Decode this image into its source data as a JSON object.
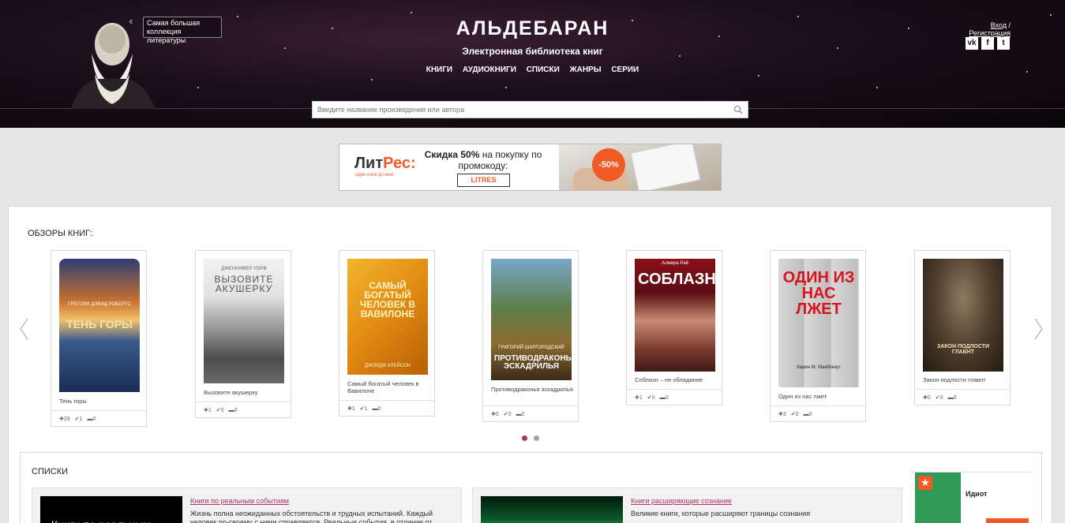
{
  "header": {
    "collection_text": "Самая большая коллекция литературы",
    "logo": "АЛЬДЕБАРАН",
    "tagline": "Электронная библиотека книг",
    "nav": [
      "КНИГИ",
      "АУДИОКНИГИ",
      "СПИСКИ",
      "ЖАНРЫ",
      "СЕРИИ"
    ],
    "auth": {
      "login": "Вход",
      "separator": " / ",
      "register": "Регистрация"
    },
    "socials": [
      "vk-icon",
      "facebook-icon",
      "twitter-icon"
    ]
  },
  "search": {
    "placeholder": "Введите название произведения или автора"
  },
  "banner": {
    "logo_main": "Лит",
    "logo_accent": "Рес:",
    "logo_sub": "один клик до книг",
    "promo_bold": "Скидка 50%",
    "promo_rest": " на покупку по промокоду:",
    "promo_code": "LITRES",
    "discount": "-50%"
  },
  "reviews": {
    "title": "ОБЗОРЫ КНИГ:",
    "books": [
      {
        "cover_title": "ТЕНЬ ГОРЫ",
        "cover_author": "ГРЕГОРИ ДЭВИД РОБЕРТС",
        "title": "Тень горы",
        "likes": "29",
        "checks": "1",
        "comments": "0"
      },
      {
        "cover_title": "ВЫЗОВИТЕ АКУШЕРКУ",
        "cover_author": "ДЖЕННИФЕР УОРФ",
        "title": "Вызовите акушерку",
        "likes": "1",
        "checks": "0",
        "comments": "0"
      },
      {
        "cover_title": "САМЫЙ БОГАТЫЙ ЧЕЛОВЕК В ВАВИЛОНЕ",
        "cover_author": "ДЖОРДЖ КЛЕЙСОН",
        "title": "Самый богатый человек в Вавилоне",
        "likes": "1",
        "checks": "1",
        "comments": "0"
      },
      {
        "cover_title": "ПРОТИВОДРАКОНЬЯ ЭСКАДРИЛЬЯ",
        "cover_author": "ГРИГОРИЙ ШАРГОРОДСКИЙ",
        "title": "Противодраконья эскадрилья",
        "likes": "0",
        "checks": "0",
        "comments": "0"
      },
      {
        "cover_title": "СОБЛАЗН",
        "cover_author": "Алмира Рай",
        "title": "Соблазн – не обладание",
        "likes": "1",
        "checks": "0",
        "comments": "0"
      },
      {
        "cover_title": "ОДИН ИЗ НАС ЛЖЕТ",
        "cover_author": "Карен М. МакМанус",
        "title": "Один из нас лжет",
        "likes": "3",
        "checks": "0",
        "comments": "0"
      },
      {
        "cover_title": "ЗАКОН ПОДЛОСТИ ГЛАВНТ",
        "cover_author": "",
        "title": "Закон подлости главнт",
        "likes": "0",
        "checks": "0",
        "comments": "0"
      }
    ],
    "colors": {
      "dot_active": "#b0306b",
      "dot_inactive": "#9aa6a6"
    }
  },
  "lists": {
    "title": "СПИСКИ",
    "items": [
      {
        "link": "Книги по реальным событиям",
        "desc": "Жизнь полна неожиданных обстоятельств и трудных испытаний. Каждый человек по-своему с ними справляется. Реальные события, в отличие от",
        "thumb_text": "Книги по реальным"
      },
      {
        "link": "Книги расширяющие сознание",
        "desc": "Великие книги, которые расширяют границы сознания",
        "thumb_text": ""
      }
    ],
    "side_book": "Идиот"
  }
}
